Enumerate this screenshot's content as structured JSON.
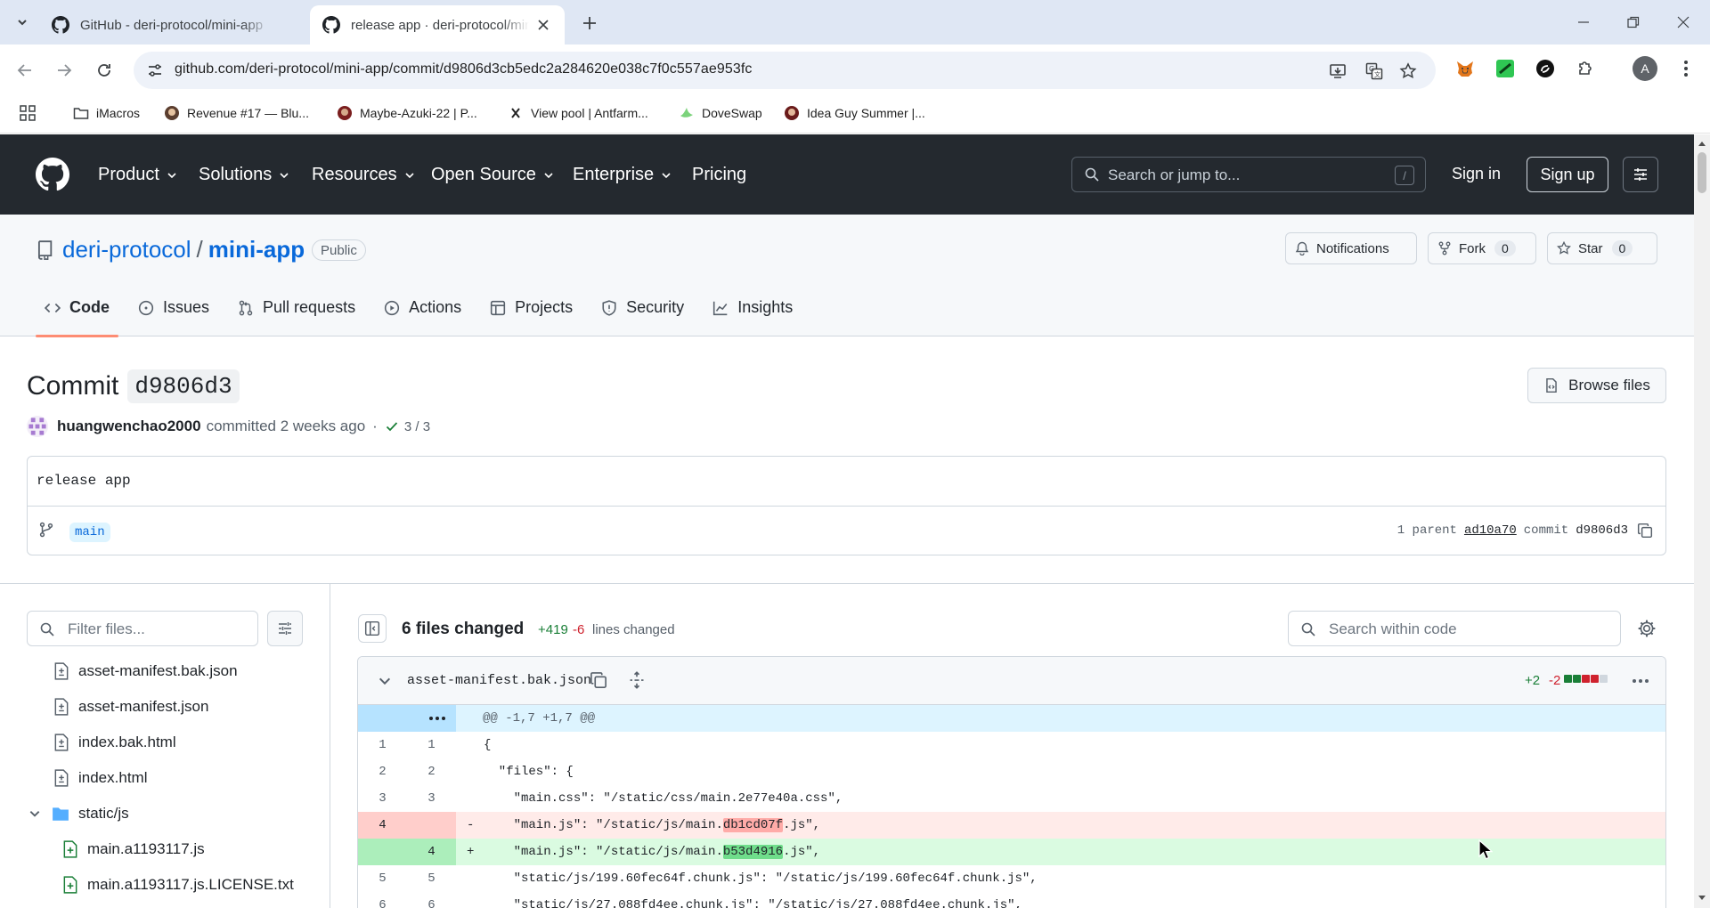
{
  "browser": {
    "tabs": [
      {
        "title": "GitHub - deri-protocol/mini-app",
        "active": false
      },
      {
        "title": "release app · deri-protocol/mini-app",
        "active": true
      }
    ],
    "url": "github.com/deri-protocol/mini-app/commit/d9806d3cb5edc2a284620e038c7f0c557ae953fc",
    "profile_initial": "A",
    "bookmarks": [
      {
        "label": "iMacros",
        "icon": "folder-icon"
      },
      {
        "label": "Revenue #17 — Blu...",
        "icon": "site-icon"
      },
      {
        "label": "Maybe-Azuki-22 | P...",
        "icon": "site-icon"
      },
      {
        "label": "View pool | Antfarm...",
        "icon": "site-icon"
      },
      {
        "label": "DoveSwap",
        "icon": "site-icon"
      },
      {
        "label": "Idea Guy Summer |...",
        "icon": "site-icon"
      }
    ]
  },
  "gh_header": {
    "nav": [
      "Product",
      "Solutions",
      "Resources",
      "Open Source",
      "Enterprise",
      "Pricing"
    ],
    "search_placeholder": "Search or jump to...",
    "search_key": "/",
    "sign_in": "Sign in",
    "sign_up": "Sign up"
  },
  "repo": {
    "owner": "deri-protocol",
    "separator": "/",
    "name": "mini-app",
    "visibility": "Public",
    "notifications_label": "Notifications",
    "fork_label": "Fork",
    "fork_count": "0",
    "star_label": "Star",
    "star_count": "0",
    "tabs": [
      "Code",
      "Issues",
      "Pull requests",
      "Actions",
      "Projects",
      "Security",
      "Insights"
    ],
    "selected_tab": "Code"
  },
  "commit": {
    "title_prefix": "Commit",
    "short_sha": "d9806d3",
    "browse_files": "Browse files",
    "author": "huangwenchao2000",
    "action": "committed",
    "when": "2 weeks ago",
    "dot": "·",
    "checks": "3 / 3",
    "message": "release app",
    "branch": "main",
    "parent_label": "1 parent",
    "parent_sha": "ad10a70",
    "commit_label": "commit",
    "commit_sha": "d9806d3"
  },
  "file_tree": {
    "filter_placeholder": "Filter files...",
    "items": [
      {
        "name": "asset-manifest.bak.json",
        "type": "file"
      },
      {
        "name": "asset-manifest.json",
        "type": "file"
      },
      {
        "name": "index.bak.html",
        "type": "file"
      },
      {
        "name": "index.html",
        "type": "file"
      },
      {
        "name": "static/js",
        "type": "folder"
      },
      {
        "name": "main.a1193117.js",
        "type": "added-file"
      },
      {
        "name": "main.a1193117.js.LICENSE.txt",
        "type": "added-file"
      }
    ]
  },
  "diff_summary": {
    "files_changed": "6 files changed",
    "additions": "+419",
    "deletions": "-6",
    "lines_label": "lines changed",
    "search_placeholder": "Search within code"
  },
  "diff_file": {
    "filename": "asset-manifest.bak.json",
    "additions": "+2",
    "deletions": "-2",
    "hunk": "@@ -1,7 +1,7 @@",
    "lines": [
      {
        "old": "1",
        "new": "1",
        "type": "ctx",
        "sign": "",
        "text": "{"
      },
      {
        "old": "2",
        "new": "2",
        "type": "ctx",
        "sign": "",
        "text": "  \"files\": {"
      },
      {
        "old": "3",
        "new": "3",
        "type": "ctx",
        "sign": "",
        "text": "    \"main.css\": \"/static/css/main.2e77e40a.css\","
      },
      {
        "old": "4",
        "new": "",
        "type": "del",
        "sign": "-",
        "pre": "    \"main.js\": \"/static/js/main.",
        "hl": "db1cd07f",
        "post": ".js\","
      },
      {
        "old": "",
        "new": "4",
        "type": "add",
        "sign": "+",
        "pre": "    \"main.js\": \"/static/js/main.",
        "hl": "b53d4916",
        "post": ".js\","
      },
      {
        "old": "5",
        "new": "5",
        "type": "ctx",
        "sign": "",
        "text": "    \"static/js/199.60fec64f.chunk.js\": \"/static/js/199.60fec64f.chunk.js\","
      },
      {
        "old": "6",
        "new": "6",
        "type": "ctx",
        "sign": "",
        "text": "    \"static/js/27.088fd4ee.chunk.js\": \"/static/js/27.088fd4ee.chunk.js\","
      }
    ]
  },
  "colors": {
    "header_bg": "#24292f",
    "link": "#0969da",
    "add": "#1a7f37",
    "del": "#cf222e",
    "tab_underline": "#fd8c73"
  }
}
